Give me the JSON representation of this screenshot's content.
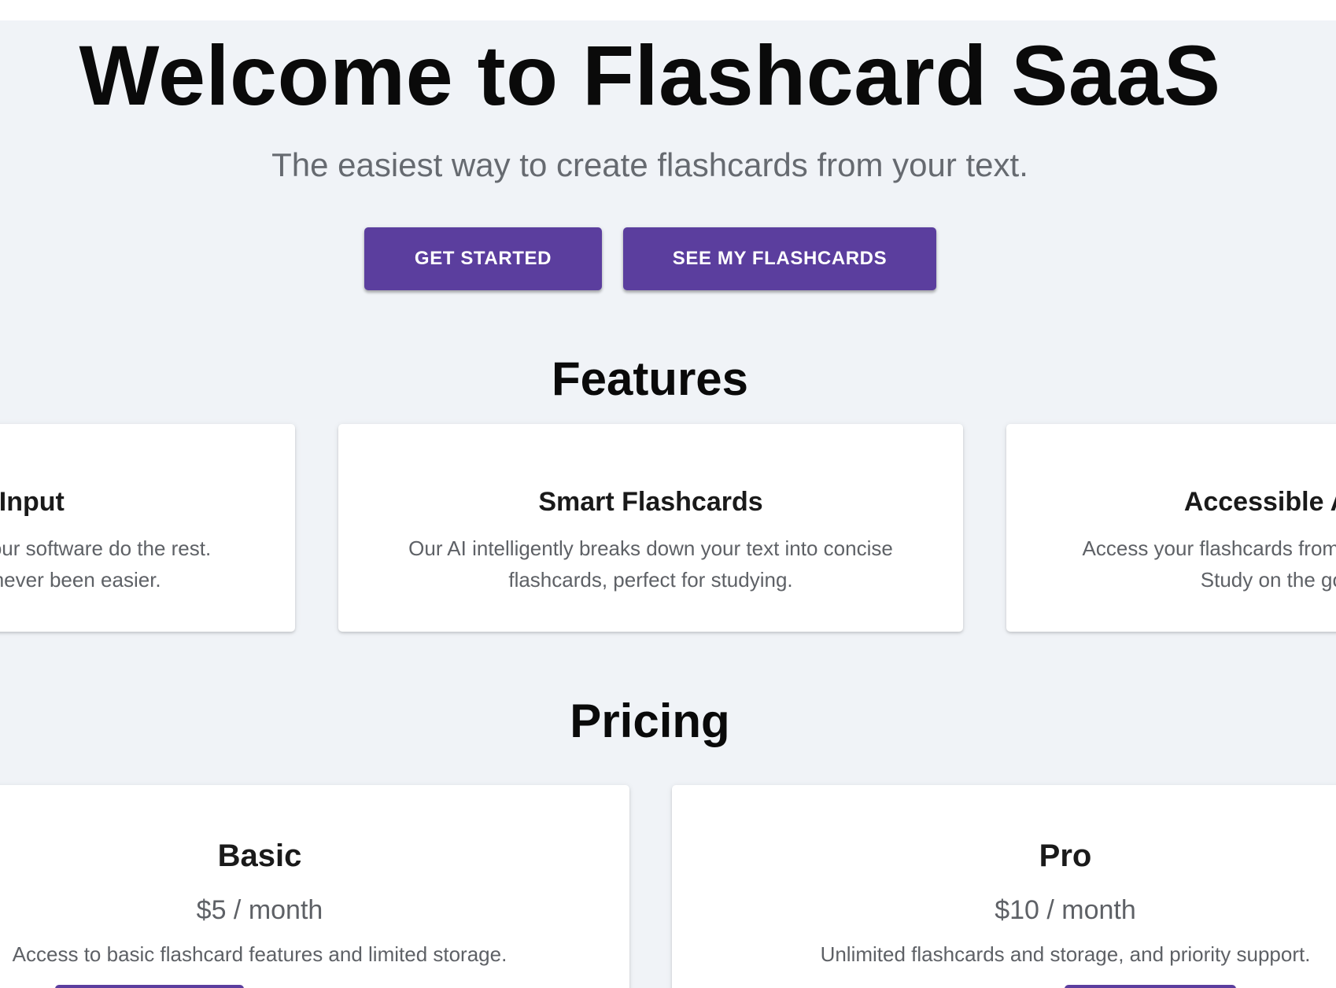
{
  "hero": {
    "title": "Welcome to Flashcard SaaS",
    "subtitle": "The easiest way to create flashcards from your text."
  },
  "buttons": {
    "get_started": "GET STARTED",
    "see_flashcards": "SEE MY FLASHCARDS"
  },
  "features": {
    "heading": "Features",
    "items": [
      {
        "title": "Easy Text Input",
        "lines": [
          "Simply input your text and let our software do the rest.",
          "Creating flashcards has never been easier."
        ]
      },
      {
        "title": "Smart Flashcards",
        "lines": [
          "Our AI intelligently breaks down your text into concise",
          "flashcards, perfect for studying."
        ]
      },
      {
        "title": "Accessible Anywhere",
        "lines": [
          "Access your flashcards from any device, at any time.",
          "Study on the go with ease."
        ]
      }
    ]
  },
  "pricing": {
    "heading": "Pricing",
    "plans": [
      {
        "name": "Basic",
        "price": "$5 / month",
        "description": "Access to basic flashcard features and limited storage.",
        "button": ""
      },
      {
        "name": "Pro",
        "price": "$10 / month",
        "description": "Unlimited flashcards and storage, and priority support.",
        "button": ""
      }
    ]
  },
  "colors": {
    "accent": "#5b3e9e",
    "background": "#f0f3f7",
    "card": "#ffffff",
    "heading": "#0a0a0a",
    "muted_text": "#5e6166"
  }
}
